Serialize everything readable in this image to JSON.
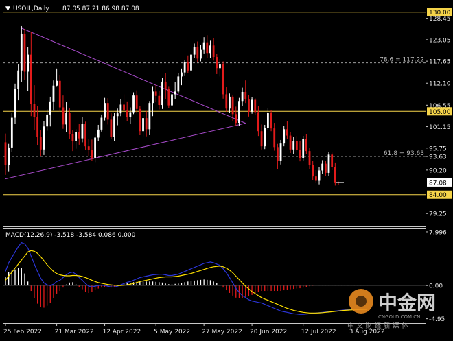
{
  "header": {
    "symbol": "USOIL,Daily",
    "ohlc": "87.05 87.21 86.98 87.08"
  },
  "watermark": {
    "logo_text": "中金网",
    "site": "CNGOLD.COM.CN",
    "tagline": "中 文 财 经 新 媒 体"
  },
  "chart_data": [
    {
      "type": "candlestick",
      "panel": "price",
      "ylim": [
        76.0,
        132.2
      ],
      "y_ticks": [
        "130.00",
        "128.45",
        "123.05",
        "117.65",
        "112.10",
        "106.55",
        "105.00",
        "101.15",
        "95.75",
        "93.63",
        "90.20",
        "87.08",
        "84.00",
        "79.25"
      ],
      "x_ticks": [
        "25 Feb 2022",
        "21 Mar 2022",
        "12 Apr 2022",
        "5 May 2022",
        "27 May 2022",
        "20 Jun 2022",
        "12 Jul 2022",
        "3 Aug 2022"
      ],
      "x_tick_index": [
        0,
        16,
        31,
        47,
        62,
        77,
        93,
        108
      ],
      "levels": [
        {
          "value": 130.0,
          "label": "130.00",
          "style": "solid",
          "color": "#f5d44a"
        },
        {
          "value": 117.22,
          "label": "78.6 = 117.22",
          "style": "dashed",
          "color": "#9a9a9a"
        },
        {
          "value": 105.0,
          "label": "105.00",
          "style": "solid",
          "color": "#f5d44a"
        },
        {
          "value": 93.63,
          "label": "61.8 = 93.63",
          "style": "dashed",
          "color": "#9a9a9a"
        },
        {
          "value": 84.0,
          "label": "84.00",
          "style": "solid",
          "color": "#f5d44a"
        }
      ],
      "current_price": 87.08,
      "trendlines": [
        {
          "from": [
            5,
            126.0
          ],
          "to": [
            75,
            102.0
          ],
          "color": "#a64ac9"
        },
        {
          "from": [
            0,
            88.0
          ],
          "to": [
            75,
            102.0
          ],
          "color": "#a64ac9"
        }
      ],
      "colors": {
        "up": "#ffffff",
        "down": "#e31b1b",
        "grid": "none"
      },
      "ohlc": [
        [
          97.2,
          99.4,
          89.0,
          91.5
        ],
        [
          91.5,
          96.8,
          89.9,
          95.9
        ],
        [
          95.9,
          104.6,
          94.8,
          103.4
        ],
        [
          103.4,
          112.0,
          101.8,
          110.6
        ],
        [
          110.6,
          116.9,
          107.8,
          115.3
        ],
        [
          115.3,
          126.5,
          112.4,
          124.6
        ],
        [
          124.6,
          125.8,
          112.9,
          115.0
        ],
        [
          115.0,
          121.2,
          110.1,
          119.3
        ],
        [
          119.3,
          125.1,
          103.8,
          106.9
        ],
        [
          106.9,
          111.6,
          100.2,
          103.5
        ],
        [
          103.5,
          106.4,
          96.4,
          98.5
        ],
        [
          98.5,
          100.3,
          93.8,
          95.4
        ],
        [
          95.4,
          102.5,
          94.0,
          101.2
        ],
        [
          101.2,
          105.5,
          100.1,
          104.2
        ],
        [
          104.2,
          108.7,
          101.2,
          107.5
        ],
        [
          107.5,
          112.8,
          105.2,
          111.5
        ],
        [
          111.5,
          115.8,
          111.2,
          112.7
        ],
        [
          112.7,
          114.1,
          105.0,
          106.0
        ],
        [
          106.0,
          109.0,
          100.6,
          101.7
        ],
        [
          101.7,
          107.3,
          99.8,
          104.6
        ],
        [
          104.6,
          105.8,
          98.0,
          99.3
        ],
        [
          99.3,
          100.2,
          95.0,
          97.6
        ],
        [
          97.6,
          100.5,
          95.6,
          99.8
        ],
        [
          99.8,
          101.8,
          96.6,
          98.2
        ],
        [
          98.2,
          103.5,
          97.2,
          101.8
        ],
        [
          101.8,
          102.4,
          95.2,
          96.2
        ],
        [
          96.2,
          98.0,
          93.7,
          95.2
        ],
        [
          95.2,
          97.9,
          92.5,
          93.3
        ],
        [
          93.3,
          99.4,
          92.2,
          98.4
        ],
        [
          98.4,
          101.6,
          97.5,
          100.4
        ],
        [
          100.4,
          104.2,
          99.9,
          103.4
        ],
        [
          103.4,
          108.4,
          102.7,
          107.1
        ],
        [
          107.1,
          108.3,
          101.7,
          102.9
        ],
        [
          102.9,
          104.6,
          98.0,
          98.6
        ],
        [
          98.6,
          104.7,
          97.6,
          103.8
        ],
        [
          103.8,
          105.7,
          101.5,
          104.5
        ],
        [
          104.5,
          108.0,
          103.8,
          106.7
        ],
        [
          106.7,
          109.3,
          104.4,
          105.2
        ],
        [
          105.2,
          107.5,
          102.5,
          103.5
        ],
        [
          103.5,
          106.0,
          101.8,
          104.8
        ],
        [
          104.8,
          109.8,
          104.3,
          109.0
        ],
        [
          109.0,
          110.3,
          104.5,
          105.6
        ],
        [
          105.6,
          106.4,
          99.0,
          100.0
        ],
        [
          100.0,
          104.1,
          98.7,
          103.3
        ],
        [
          103.3,
          105.1,
          98.7,
          100.5
        ],
        [
          100.5,
          107.6,
          99.0,
          107.1
        ],
        [
          107.1,
          111.2,
          103.8,
          110.0
        ],
        [
          110.0,
          111.7,
          107.3,
          108.9
        ],
        [
          108.9,
          110.1,
          105.5,
          106.6
        ],
        [
          106.6,
          113.5,
          105.6,
          112.5
        ],
        [
          112.5,
          114.7,
          108.0,
          110.6
        ],
        [
          110.6,
          111.2,
          105.9,
          106.5
        ],
        [
          106.5,
          110.0,
          104.7,
          109.3
        ],
        [
          109.3,
          112.4,
          108.1,
          110.0
        ],
        [
          110.0,
          114.7,
          109.5,
          113.8
        ],
        [
          113.8,
          115.8,
          111.6,
          114.8
        ],
        [
          114.8,
          117.9,
          113.9,
          117.4
        ],
        [
          117.4,
          119.1,
          114.6,
          115.3
        ],
        [
          115.3,
          120.0,
          114.8,
          119.3
        ],
        [
          119.3,
          122.1,
          118.5,
          121.2
        ],
        [
          121.2,
          122.6,
          117.3,
          118.3
        ],
        [
          118.3,
          121.8,
          117.6,
          120.5
        ],
        [
          120.5,
          123.7,
          119.6,
          122.4
        ],
        [
          122.4,
          124.2,
          118.5,
          119.7
        ],
        [
          119.7,
          122.8,
          118.4,
          121.6
        ],
        [
          121.6,
          123.4,
          117.8,
          118.7
        ],
        [
          118.7,
          119.5,
          114.4,
          115.9
        ],
        [
          115.9,
          118.2,
          113.8,
          116.8
        ],
        [
          116.8,
          117.6,
          108.2,
          109.3
        ],
        [
          109.3,
          111.1,
          104.9,
          105.7
        ],
        [
          105.7,
          109.5,
          104.6,
          108.7
        ],
        [
          108.7,
          109.0,
          102.6,
          104.3
        ],
        [
          104.3,
          106.2,
          101.3,
          102.1
        ],
        [
          102.1,
          108.4,
          101.4,
          107.6
        ],
        [
          107.6,
          111.0,
          106.4,
          109.9
        ],
        [
          109.9,
          112.8,
          107.1,
          108.0
        ],
        [
          108.0,
          109.2,
          103.7,
          104.9
        ],
        [
          104.9,
          108.6,
          104.4,
          107.9
        ],
        [
          107.9,
          108.3,
          104.0,
          104.8
        ],
        [
          104.8,
          106.4,
          98.8,
          100.0
        ],
        [
          100.0,
          101.7,
          95.4,
          96.2
        ],
        [
          96.2,
          101.6,
          95.5,
          100.9
        ],
        [
          100.9,
          105.8,
          100.4,
          104.6
        ],
        [
          104.6,
          105.4,
          100.0,
          100.7
        ],
        [
          100.7,
          102.1,
          95.1,
          96.0
        ],
        [
          96.0,
          96.8,
          90.4,
          92.6
        ],
        [
          92.6,
          97.8,
          91.6,
          96.9
        ],
        [
          96.9,
          101.3,
          96.2,
          100.5
        ],
        [
          100.5,
          102.6,
          98.0,
          98.9
        ],
        [
          98.9,
          99.8,
          94.5,
          95.4
        ],
        [
          95.4,
          98.5,
          94.3,
          97.6
        ],
        [
          97.6,
          98.8,
          94.6,
          95.2
        ],
        [
          95.2,
          97.6,
          92.4,
          93.3
        ],
        [
          93.3,
          98.8,
          92.6,
          98.0
        ],
        [
          98.0,
          99.3,
          94.3,
          95.0
        ],
        [
          95.0,
          95.8,
          90.5,
          91.4
        ],
        [
          91.4,
          92.5,
          87.6,
          88.6
        ],
        [
          88.6,
          90.2,
          86.9,
          87.5
        ],
        [
          87.5,
          90.9,
          86.6,
          90.1
        ],
        [
          90.1,
          92.7,
          89.3,
          91.8
        ],
        [
          91.8,
          92.5,
          88.7,
          89.5
        ],
        [
          89.5,
          94.8,
          88.8,
          94.1
        ],
        [
          94.1,
          94.6,
          90.2,
          90.9
        ],
        [
          90.9,
          92.1,
          86.3,
          87.1
        ],
        [
          87.1,
          87.3,
          86.4,
          87.08
        ]
      ]
    },
    {
      "type": "macd",
      "panel": "indicator",
      "label": "MACD(12,26,9) -3.518 -3.584 0.086 0.000",
      "ylim": [
        -5.6,
        8.4
      ],
      "y_ticks": [
        "7.996",
        "0.00",
        "-4.95"
      ],
      "colors": {
        "macd": "#2b35d8",
        "signal": "#ffe100",
        "hist_up": "#ffffff",
        "hist_down": "#e31b1b"
      },
      "macd": [
        2.1,
        3.4,
        4.2,
        5.0,
        5.8,
        6.4,
        6.2,
        5.6,
        4.4,
        3.2,
        2.1,
        1.1,
        0.4,
        0.1,
        0.0,
        0.2,
        0.6,
        0.8,
        1.2,
        1.6,
        1.9,
        2.0,
        1.7,
        1.2,
        0.8,
        0.3,
        -0.1,
        -0.2,
        -0.1,
        0.0,
        0.05,
        0.0,
        -0.1,
        -0.2,
        -0.2,
        -0.1,
        0.1,
        0.3,
        0.5,
        0.6,
        0.8,
        1.0,
        1.2,
        1.3,
        1.4,
        1.5,
        1.6,
        1.65,
        1.7,
        1.7,
        1.6,
        1.5,
        1.5,
        1.6,
        1.7,
        1.9,
        2.1,
        2.3,
        2.5,
        2.7,
        2.9,
        3.1,
        3.3,
        3.4,
        3.5,
        3.4,
        3.2,
        3.0,
        2.5,
        1.9,
        1.2,
        0.4,
        -0.4,
        -1.0,
        -1.5,
        -1.8,
        -2.1,
        -2.3,
        -2.4,
        -2.5,
        -2.6,
        -2.8,
        -3.0,
        -3.2,
        -3.4,
        -3.6,
        -3.8,
        -3.9,
        -4.0,
        -4.1,
        -4.2,
        -4.25,
        -4.3,
        -4.3,
        -4.25,
        -4.2,
        -4.15,
        -4.1,
        -4.05,
        -4.0,
        -3.95,
        -3.9,
        -3.85,
        -3.8,
        -3.75,
        -3.7,
        -3.65,
        -3.62,
        -3.6,
        -3.58,
        -3.56,
        -3.55,
        -3.55,
        -3.52
      ],
      "signal": [
        0.8,
        1.4,
        2.0,
        2.6,
        3.2,
        3.8,
        4.4,
        5.0,
        5.2,
        5.1,
        4.8,
        4.3,
        3.7,
        3.1,
        2.6,
        2.1,
        1.8,
        1.6,
        1.5,
        1.45,
        1.45,
        1.5,
        1.5,
        1.45,
        1.35,
        1.2,
        1.0,
        0.8,
        0.6,
        0.45,
        0.35,
        0.25,
        0.15,
        0.1,
        0.05,
        0.0,
        0.0,
        0.05,
        0.1,
        0.2,
        0.3,
        0.45,
        0.6,
        0.7,
        0.8,
        0.9,
        1.0,
        1.1,
        1.2,
        1.25,
        1.3,
        1.3,
        1.3,
        1.35,
        1.4,
        1.5,
        1.6,
        1.7,
        1.8,
        1.95,
        2.1,
        2.25,
        2.4,
        2.55,
        2.7,
        2.8,
        2.85,
        2.9,
        2.8,
        2.6,
        2.3,
        1.9,
        1.4,
        0.9,
        0.4,
        -0.1,
        -0.5,
        -0.9,
        -1.2,
        -1.5,
        -1.8,
        -2.0,
        -2.2,
        -2.4,
        -2.6,
        -2.8,
        -3.0,
        -3.2,
        -3.4,
        -3.55,
        -3.7,
        -3.8,
        -3.9,
        -4.0,
        -4.05,
        -4.1,
        -4.1,
        -4.1,
        -4.08,
        -4.05,
        -4.0,
        -3.95,
        -3.9,
        -3.85,
        -3.8,
        -3.75,
        -3.7,
        -3.67,
        -3.64,
        -3.62,
        -3.6,
        -3.59,
        -3.58,
        -3.58
      ]
    }
  ]
}
